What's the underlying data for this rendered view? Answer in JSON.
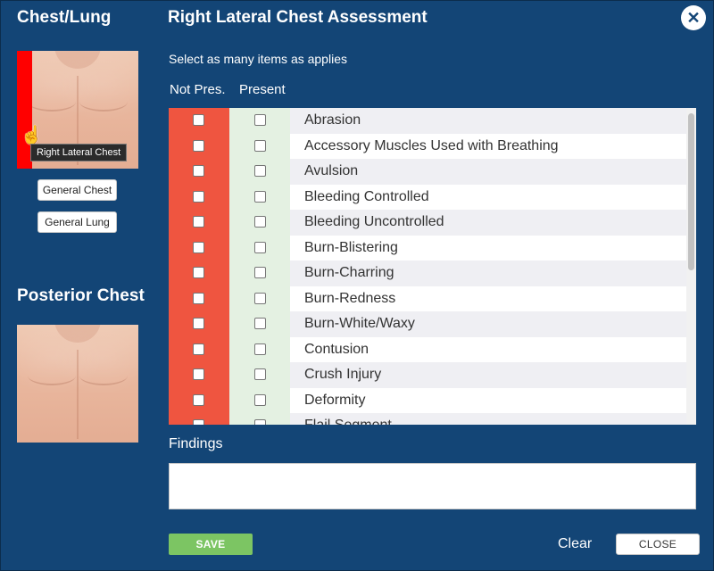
{
  "sidebar": {
    "section_top_title": "Chest/Lung",
    "tooltip": "Right Lateral Chest",
    "general_chest_label": "General Chest",
    "general_lung_label": "General Lung",
    "section_bottom_title": "Posterior Chest"
  },
  "header": {
    "title": "Right Lateral Chest Assessment",
    "close_glyph": "✕"
  },
  "instruction": "Select as many items as applies",
  "columns": {
    "not_present": "Not Pres.",
    "present": "Present"
  },
  "items": [
    {
      "label": "Abrasion"
    },
    {
      "label": "Accessory Muscles Used with Breathing"
    },
    {
      "label": "Avulsion"
    },
    {
      "label": "Bleeding Controlled"
    },
    {
      "label": "Bleeding Uncontrolled"
    },
    {
      "label": "Burn-Blistering"
    },
    {
      "label": "Burn-Charring"
    },
    {
      "label": "Burn-Redness"
    },
    {
      "label": "Burn-White/Waxy"
    },
    {
      "label": "Contusion"
    },
    {
      "label": "Crush Injury"
    },
    {
      "label": "Deformity"
    },
    {
      "label": "Flail Segment"
    }
  ],
  "findings": {
    "label": "Findings",
    "value": ""
  },
  "footer": {
    "save_label": "SAVE",
    "clear_label": "Clear",
    "close_label": "CLOSE"
  },
  "colors": {
    "background": "#134576",
    "not_present_column": "#ef5540",
    "present_column": "#e4f1e2",
    "save_button": "#7cc563",
    "highlight_strip": "#ff0000"
  },
  "icons": {
    "close": "close-icon",
    "cursor": "hand-pointer-icon"
  }
}
